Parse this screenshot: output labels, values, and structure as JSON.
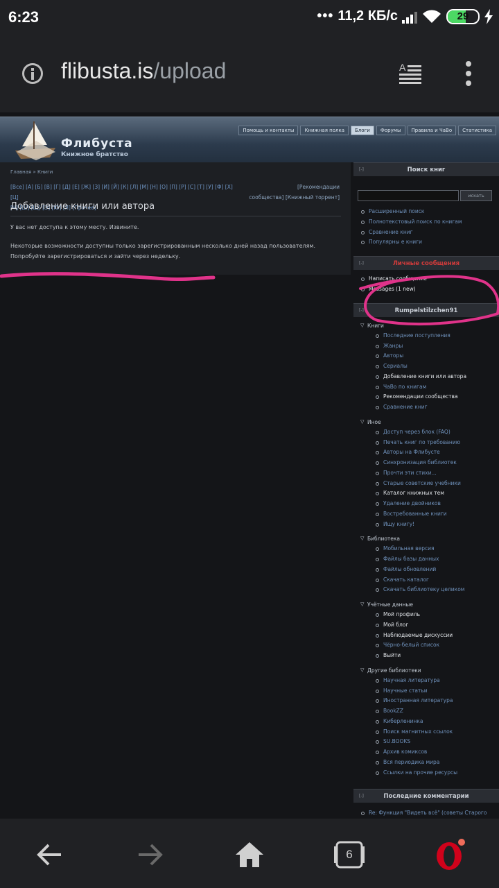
{
  "status": {
    "time": "6:23",
    "network_rate": "11,2 КБ/с",
    "battery": "29"
  },
  "browser": {
    "url_host": "flibusta.is",
    "url_path": "/upload",
    "tab_count": "6"
  },
  "site": {
    "title": "Флибуста",
    "subtitle": "Книжное братство",
    "nav": [
      "Помощь и контакты",
      "Книжная полка",
      "Блоги",
      "Форумы",
      "Правила и ЧаВо",
      "Статистика"
    ],
    "active_nav": "Блоги"
  },
  "main": {
    "breadcrumb": "Главная » Книги",
    "alphabet_line1": "[Все] [А] [Б] [В] [Г] [Д] [Е] [Ж] [З] [И] [Й] [К] [Л] [М] [Н] [О] [П] [Р] [С] [Т] [У] [Ф] [Х] [Ц]",
    "alphabet_line2": "[Ч] [Ш] [Щ] [Э] [Ю] [Я] [Прочее]",
    "recs_line1": "[Рекомендации",
    "recs_line2": "сообщества]  [Книжный торрент]",
    "heading": "Добавление книги или автора",
    "message1": "У вас нет доступа к этому месту. Извините.",
    "message2": "Некоторые возможности доступны только зарегистрированным несколько дней назад пользователям. Попробуйте зарегистрироваться и зайти через недельку."
  },
  "sidebar": {
    "search": {
      "title": "Поиск книг",
      "toggle": "[-]",
      "button": "искать",
      "links": [
        "Расширенный поиск",
        "Полнотекстовый поиск по книгам",
        "Сравнение книг",
        "Популярны е книги"
      ]
    },
    "pm": {
      "title": "Личные сообщения",
      "toggle": "[-]",
      "links": [
        "Написать сообщение",
        "Messages (1 new)"
      ]
    },
    "user": {
      "title": "Rumpelstilzchen91",
      "toggle": "[-]",
      "groups": [
        {
          "label": "Книги",
          "items": [
            "Последние поступления",
            "Жанры",
            "Авторы",
            "Сериалы",
            "Добавление книги или автора",
            "ЧаВо по книгам",
            "Рекомендации сообщества",
            "Сравнение книг"
          ]
        },
        {
          "label": "Иное",
          "items": [
            "Доступ через блок (FAQ)",
            "Печать книг по требованию",
            "Авторы на Флибусте",
            "Синхронизация библиотек",
            "Прочти эти стихи...",
            "Старые советские учебники",
            "Каталог книжных тем",
            "Удаление двойников",
            "Востребованные книги",
            "Ищу книгу!"
          ]
        },
        {
          "label": "Библиотека",
          "items": [
            "Мобильная версия",
            "Файлы базы данных",
            "Файлы обновлений",
            "Скачать каталог",
            "Скачать библиотеку целиком"
          ]
        },
        {
          "label": "Учётные данные",
          "items": [
            "Мой профиль",
            "Мой блог",
            "Наблюдаемые дискуссии",
            "Чёрно-белый список",
            "Выйти"
          ]
        },
        {
          "label": "Другие библиотеки",
          "items": [
            "Научная литература",
            "Научные статьи",
            "Иностранная литература",
            "BookZZ",
            "Киберленинка",
            "Поиск магнитных ссылок",
            "SU.BOOKS",
            "Архив комиксов",
            "Вся периодика мира",
            "Ссылки на прочие ресурсы"
          ]
        }
      ]
    },
    "comments": {
      "title": "Последние комментарии",
      "toggle": "[-]",
      "first": "Re: Функция \"Видеть всё\" (советы Старого Опера)"
    }
  },
  "colors": {
    "annotation": "#e0338a",
    "link": "#6f91bb",
    "pm_title": "#d13b3b"
  }
}
